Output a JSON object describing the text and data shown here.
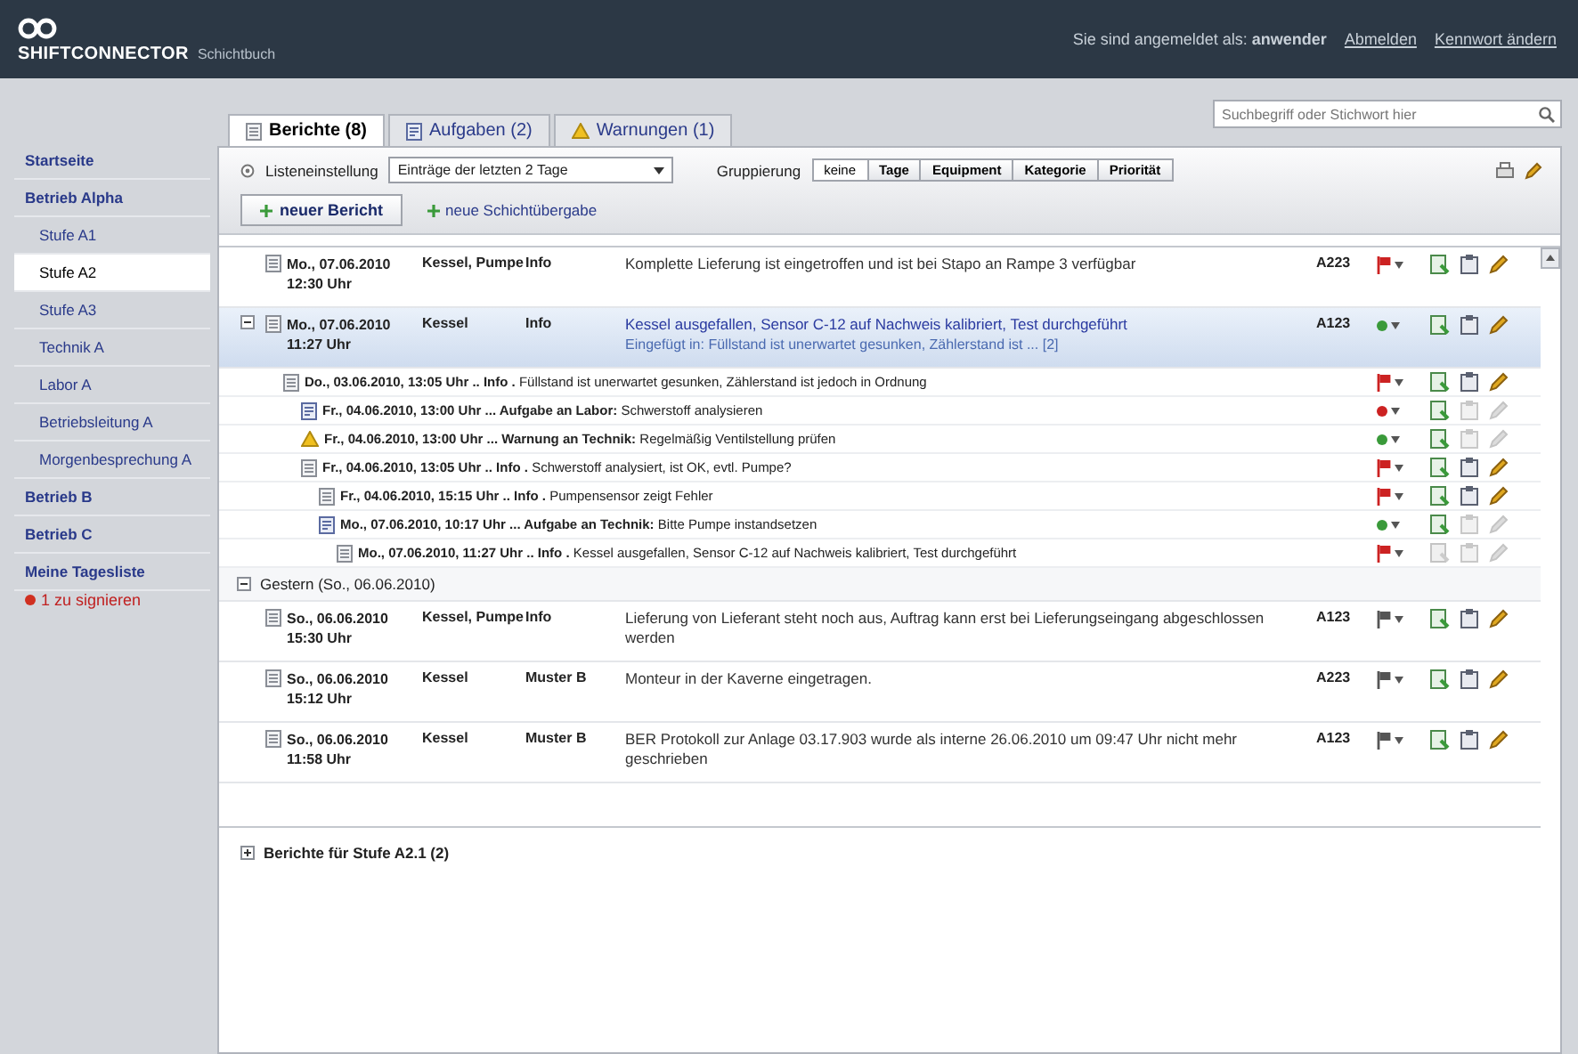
{
  "header": {
    "product": "SHIFTCONNECTOR",
    "subtitle": "Schichtbuch",
    "user_text": "Sie sind angemeldet als: **anwender**",
    "links": [
      "Abmelden",
      "Kennwort ändern"
    ]
  },
  "sidebar": {
    "items": [
      {
        "label": "Startseite",
        "selected": false
      },
      {
        "label": "Betrieb Alpha",
        "selected": false,
        "children": [
          {
            "label": "Stufe A1",
            "selected": false
          },
          {
            "label": "Stufe A2",
            "selected": true
          },
          {
            "label": "Stufe A3",
            "selected": false
          },
          {
            "label": "Technik A",
            "selected": false
          },
          {
            "label": "Labor A",
            "selected": false
          },
          {
            "label": "Betriebsleitung A",
            "selected": false
          },
          {
            "label": "Morgenbesprechung A",
            "selected": false
          }
        ]
      },
      {
        "label": "Betrieb B",
        "selected": false
      },
      {
        "label": "Betrieb C",
        "selected": false
      },
      {
        "label": "Meine Tagesliste",
        "selected": false
      }
    ],
    "notice": "1 zu signieren"
  },
  "search": {
    "placeholder": "Suchbegriff oder Stichwort hier"
  },
  "tabs": [
    {
      "label": "Berichte (8)",
      "kind": "list",
      "selected": true
    },
    {
      "label": "Aufgaben (2)",
      "kind": "task",
      "selected": false
    },
    {
      "label": "Warnungen (1)",
      "kind": "warning",
      "selected": false
    }
  ],
  "toolbar": {
    "range_label": "Listeneinstellung",
    "range_value": "Einträge der letzten 2 Tage",
    "grouping_label": "Gruppierung",
    "grouping": [
      {
        "label": "keine",
        "selected": true
      },
      {
        "label": "Tage",
        "selected": false
      },
      {
        "label": "Equipment",
        "selected": false
      },
      {
        "label": "Kategorie",
        "selected": false
      },
      {
        "label": "Priorität",
        "selected": false
      }
    ],
    "new_report": "neuer Bericht",
    "new_handover": "neue Schichtübergabe"
  },
  "sections": [
    {
      "entries": [
        {
          "date": "Mo., 07.06.2010",
          "time": "12:30 Uhr",
          "author": "Kessel, Pumpe",
          "category": "Info",
          "text": "Komplette Lieferung ist eingetroffen und ist bei Stapo an Rampe 3 verfügbar",
          "equipment": "A223",
          "status": {
            "kind": "flag",
            "color": "#cc2222"
          },
          "actions_enabled": [
            true,
            true,
            true
          ],
          "selected": false
        },
        {
          "date": "Mo., 07.06.2010",
          "time": "11:27 Uhr",
          "author": "Kessel",
          "category": "Info",
          "text": "Kessel ausgefallen, Sensor C-12 auf Nachweis kalibriert, Test durchgeführt",
          "note": "Eingefügt in: Füllstand ist unerwartet gesunken, Zählerstand ist ... [2]",
          "equipment": "A123",
          "status": {
            "kind": "dot",
            "color": "#3a9a3a"
          },
          "actions_enabled": [
            true,
            true,
            true
          ],
          "selected": true,
          "expanded": true,
          "thread": [
            {
              "kind": "note",
              "text": "**Do., 03.06.2010, 13:05 Uhr .. Info .** Füllstand ist unerwartet gesunken, Zählerstand ist jedoch in Ordnung",
              "status": {
                "kind": "flag",
                "color": "#cc2222"
              },
              "actions_enabled": [
                true,
                true,
                true
              ],
              "children": [
                {
                  "kind": "task",
                  "text": "**Fr., 04.06.2010, 13:00 Uhr ... Aufgabe an Labor:** Schwerstoff analysieren",
                  "status": {
                    "kind": "dot",
                    "color": "#cc2222"
                  },
                  "actions_enabled": [
                    true,
                    false,
                    false
                  ]
                },
                {
                  "kind": "warning",
                  "text": "**Fr., 04.06.2010, 13:00 Uhr ... Warnung an Technik:** Regelmäßig Ventilstellung prüfen",
                  "status": {
                    "kind": "dot",
                    "color": "#3a9a3a"
                  },
                  "actions_enabled": [
                    true,
                    false,
                    false
                  ]
                },
                {
                  "kind": "note",
                  "text": "**Fr., 04.06.2010, 13:05 Uhr .. Info .** Schwerstoff analysiert, ist OK, evtl. Pumpe?",
                  "status": {
                    "kind": "flag",
                    "color": "#cc2222"
                  },
                  "actions_enabled": [
                    true,
                    true,
                    true
                  ],
                  "children": [
                    {
                      "kind": "note",
                      "text": "**Fr., 04.06.2010, 15:15 Uhr .. Info .** Pumpensensor zeigt Fehler",
                      "status": {
                        "kind": "flag",
                        "color": "#cc2222"
                      },
                      "actions_enabled": [
                        true,
                        true,
                        true
                      ]
                    },
                    {
                      "kind": "task",
                      "text": "**Mo., 07.06.2010, 10:17 Uhr ... Aufgabe an Technik:** Bitte Pumpe instandsetzen",
                      "status": {
                        "kind": "dot",
                        "color": "#3a9a3a"
                      },
                      "actions_enabled": [
                        true,
                        false,
                        false
                      ],
                      "children": [
                        {
                          "kind": "note",
                          "text": "**Mo., 07.06.2010, 11:27 Uhr .. Info .** Kessel ausgefallen, Sensor C-12 auf Nachweis kalibriert, Test durchgeführt",
                          "status": {
                            "kind": "flag",
                            "color": "#cc2222"
                          },
                          "actions_enabled": [
                            false,
                            false,
                            false
                          ]
                        }
                      ]
                    }
                  ]
                }
              ]
            }
          ]
        }
      ]
    },
    {
      "title": "Gestern (So., 06.06.2010)",
      "expanded": true,
      "entries": [
        {
          "date": "So., 06.06.2010",
          "time": "15:30 Uhr",
          "author": "Kessel, Pumpe",
          "category": "Info",
          "text": "Lieferung von Lieferant steht noch aus, Auftrag kann erst bei Lieferungseingang abgeschlossen werden",
          "equipment": "A123",
          "status": {
            "kind": "flag",
            "color": "#555555"
          },
          "actions_enabled": [
            true,
            true,
            true
          ],
          "selected": false
        },
        {
          "date": "So., 06.06.2010",
          "time": "15:12 Uhr",
          "author": "Kessel",
          "category": "Muster B",
          "text": "Monteur in der Kaverne eingetragen.",
          "equipment": "A223",
          "status": {
            "kind": "flag",
            "color": "#555555"
          },
          "actions_enabled": [
            true,
            true,
            true
          ],
          "selected": false
        },
        {
          "date": "So., 06.06.2010",
          "time": "11:58 Uhr",
          "author": "Kessel",
          "category": "Muster B",
          "text": "BER Protokoll zur Anlage 03.17.903 wurde als interne 26.06.2010 um 09:47 Uhr nicht mehr geschrieben",
          "equipment": "A123",
          "status": {
            "kind": "flag",
            "color": "#555555"
          },
          "actions_enabled": [
            true,
            true,
            true
          ],
          "selected": false
        }
      ]
    }
  ],
  "subgroups": [
    {
      "title": "Berichte für Stufe A2.1 (2)",
      "expanded": false
    }
  ]
}
